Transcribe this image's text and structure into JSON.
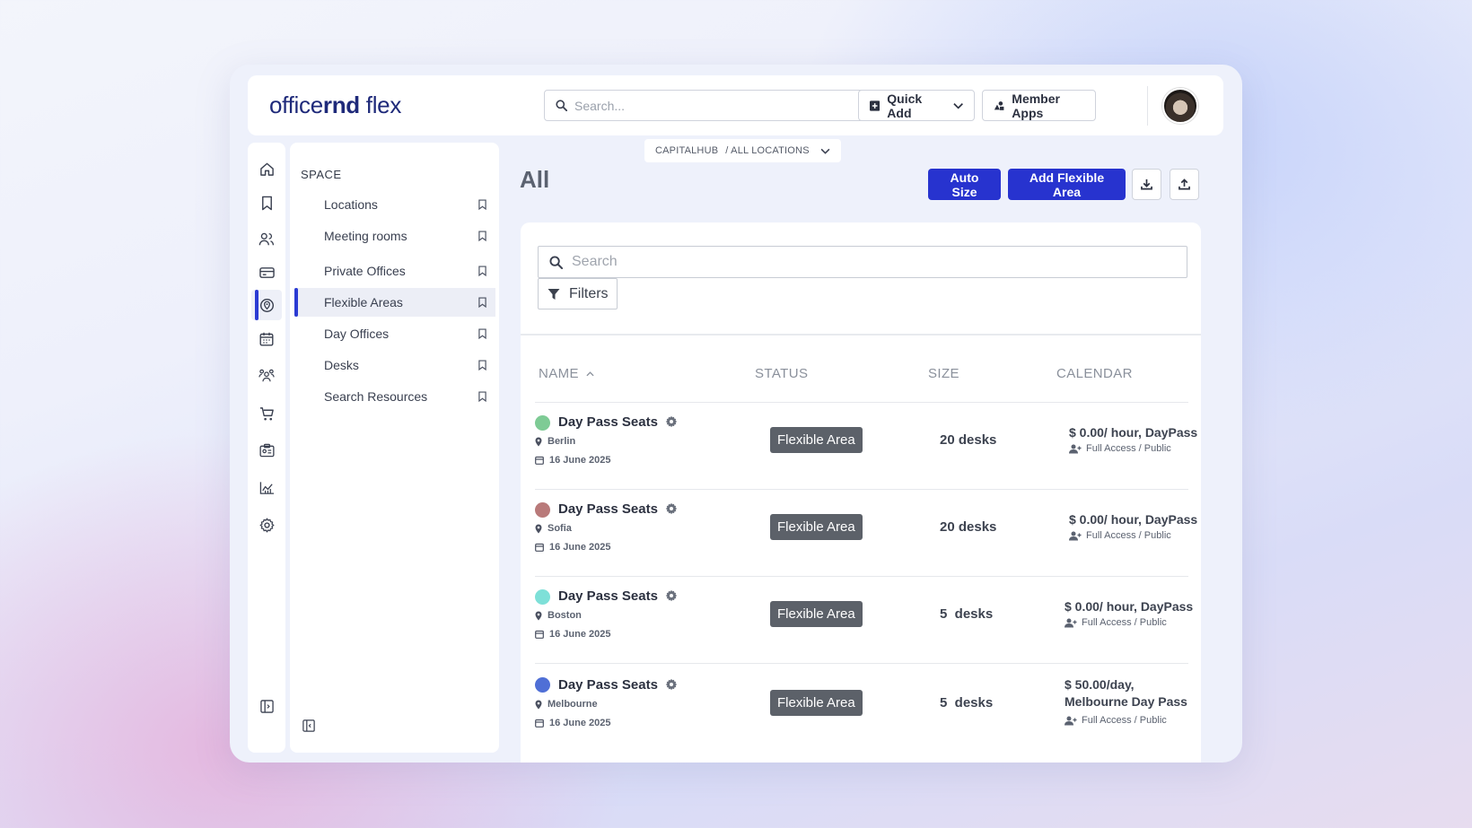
{
  "brand": {
    "name_light": "office",
    "name_bold": "rnd",
    "name_suffix": " flex"
  },
  "header": {
    "search_placeholder": "Search...",
    "quick_add_label": "Quick Add",
    "member_apps_label": "Member Apps"
  },
  "breadcrumb": {
    "org": "CAPITALHUB",
    "location": "/ ALL LOCATIONS"
  },
  "rail": {
    "icons": [
      "home-icon",
      "bookmark-icon",
      "people-icon",
      "billing-icon",
      "location-pin-icon",
      "calendar-icon",
      "community-icon",
      "cart-icon",
      "id-card-icon",
      "analytics-icon",
      "settings-icon"
    ],
    "active": "location-pin-icon"
  },
  "subnav": {
    "title": "SPACE",
    "items": [
      {
        "label": "Locations",
        "active": false
      },
      {
        "label": "Meeting rooms",
        "active": false
      },
      {
        "label": "Private Offices",
        "active": false
      },
      {
        "label": "Flexible Areas",
        "active": true
      },
      {
        "label": "Day Offices",
        "active": false
      },
      {
        "label": "Desks",
        "active": false
      },
      {
        "label": "Search Resources",
        "active": false
      }
    ]
  },
  "main": {
    "title": "All",
    "auto_size_label": "Auto Size",
    "add_label": "Add Flexible Area",
    "search_placeholder": "Search",
    "filters_label": "Filters",
    "columns": {
      "name": "NAME",
      "status": "STATUS",
      "size": "SIZE",
      "calendar": "CALENDAR"
    },
    "rows": [
      {
        "color": "#7ecb95",
        "name": "Day Pass Seats",
        "location": "Berlin",
        "date": "16 June 2025",
        "status": "Flexible Area",
        "size": "20 desks",
        "price": "$ 0.00/ hour, DayPass",
        "access": "Full Access / Public"
      },
      {
        "color": "#b97a7a",
        "name": "Day Pass Seats",
        "location": "Sofia",
        "date": "16 June 2025",
        "status": "Flexible Area",
        "size": "20 desks",
        "price": "$ 0.00/ hour, DayPass",
        "access": "Full Access / Public"
      },
      {
        "color": "#7ee0d8",
        "name": "Day Pass Seats",
        "location": "Boston",
        "date": "16 June 2025",
        "status": "Flexible Area",
        "size": "5  desks",
        "price": "$ 0.00/ hour, DayPass",
        "access": "Full Access / Public"
      },
      {
        "color": "#4f6fd6",
        "name": "Day Pass Seats",
        "location": "Melbourne",
        "date": "16 June 2025",
        "status": "Flexible Area",
        "size": "5  desks",
        "price": "$ 50.00/day, Melbourne Day Pass",
        "access": "Full Access / Public"
      }
    ]
  }
}
